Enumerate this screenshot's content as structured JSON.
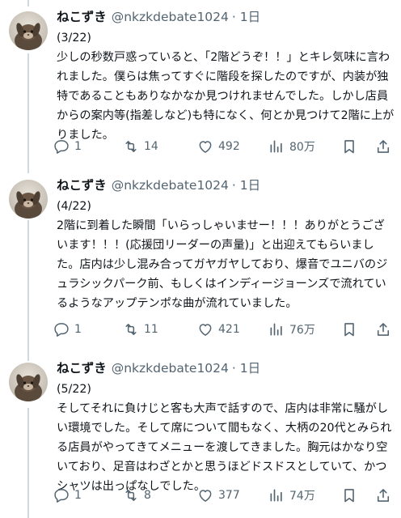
{
  "tweets": [
    {
      "name": "ねこずき",
      "handle": "@nkzkdebate1024",
      "time": "· 1日",
      "text": "(3/22)\n少しの秒数戸惑っていると、「2階どうぞ！！」とキレ気味に言われました。僕らは焦ってすぐに階段を探したのですが、内装が独特であることもありなかなか見つけれませんでした。しかし店員からの案内等(指差しなど)も特になく、何とか見つけて2階に上がりました。",
      "replies": "1",
      "retweets": "14",
      "likes": "492",
      "views": "80万"
    },
    {
      "name": "ねこずき",
      "handle": "@nkzkdebate1024",
      "time": "· 1日",
      "text": "(4/22)\n2階に到着した瞬間「いらっしゃいませー！！！ありがとうございます！！！(応援団リーダーの声量)」と出迎えてもらいました。店内は少し混み合ってガヤガヤしており、爆音でユニバのジュラシックパーク前、もしくはインディージョーンズで流れているようなアップテンポな曲が流れていました。",
      "replies": "1",
      "retweets": "11",
      "likes": "421",
      "views": "76万"
    },
    {
      "name": "ねこずき",
      "handle": "@nkzkdebate1024",
      "time": "· 1日",
      "text": "(5/22)\nそしてそれに負けじと客も大声で話すので、店内は非常に騒がしい環境でした。そして席について間もなく、大柄の20代とみられる店員がやってきてメニューを渡してきました。胸元はかなり空いており、足音はわざとかと思うほどドスドスとしていて、かつシャツは出っぱなしでした。",
      "replies": "1",
      "retweets": "8",
      "likes": "377",
      "views": "74万"
    }
  ],
  "icons": {
    "reply": "reply-icon",
    "retweet": "retweet-icon",
    "like": "heart-icon",
    "views": "views-icon",
    "bookmark": "bookmark-icon",
    "share": "share-icon"
  },
  "colors": {
    "text": "#0f1419",
    "muted": "#536471",
    "thread_line": "#cfd9de"
  }
}
